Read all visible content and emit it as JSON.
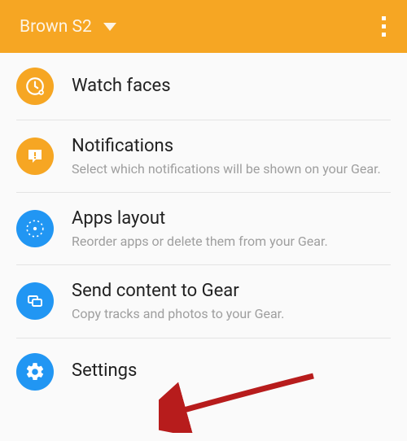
{
  "header": {
    "device_name": "Brown S2"
  },
  "items": [
    {
      "title": "Watch faces",
      "subtitle": null,
      "icon_color": "orange"
    },
    {
      "title": "Notifications",
      "subtitle": "Select which notifications will be shown on your Gear.",
      "icon_color": "orange"
    },
    {
      "title": "Apps layout",
      "subtitle": "Reorder apps or delete them from your Gear.",
      "icon_color": "blue"
    },
    {
      "title": "Send content to Gear",
      "subtitle": "Copy tracks and photos to your Gear.",
      "icon_color": "blue"
    },
    {
      "title": "Settings",
      "subtitle": null,
      "icon_color": "blue"
    }
  ]
}
